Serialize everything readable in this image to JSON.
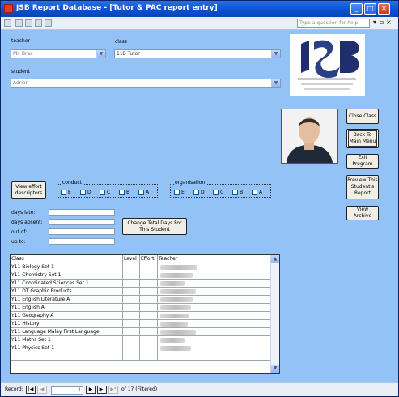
{
  "window": {
    "title": "JSB Report Database - [Tutor & PAC report entry]"
  },
  "menubar": {
    "help_placeholder": "Type a question for help"
  },
  "form": {
    "teacher_label": "teacher",
    "teacher_value": "Mr. Brax",
    "class_label": "class",
    "class_value": "11B Tutor",
    "student_label": "student",
    "student_value": "Adrian"
  },
  "buttons": {
    "close_class": "Close Class",
    "back_to_menu": "Back To Main Menu",
    "exit_program": "Exit Program",
    "preview_report": "Preview This Student's Report",
    "view_archive": "View Archive",
    "view_effort": "View effort descriptors",
    "change_total_days": "Change Total Days For This Student"
  },
  "conduct": {
    "label": "conduct",
    "options": [
      "E",
      "D",
      "C",
      "B",
      "A"
    ]
  },
  "organisation": {
    "label": "organisation",
    "options": [
      "E",
      "D",
      "C",
      "B",
      "A"
    ]
  },
  "attendance": {
    "days_late_label": "days late:",
    "days_absent_label": "days absent:",
    "out_of_label": "out of:",
    "up_to_label": "up to:"
  },
  "grid": {
    "headers": [
      "Class",
      "Level",
      "Effort",
      "Teacher"
    ],
    "rows": [
      "Y11 Biology Set 1",
      "Y11 Chemistry Set 1",
      "Y11 Coordinated Sciences Set 1",
      "Y11 DT Graphic Products",
      "Y11 English  Literature A",
      "Y11 English A",
      "Y11 Geography A",
      "Y11 History",
      "Y11 Language Malay First Language",
      "Y11 Maths Set 1",
      "Y11 Physics Set 1"
    ]
  },
  "status": {
    "record_label": "Record:",
    "record_number": "1",
    "of_text": "of  17 (Filtered)"
  },
  "colors": {
    "form_bg": "#93c2f7",
    "titlebar": "#0a4fd1"
  }
}
